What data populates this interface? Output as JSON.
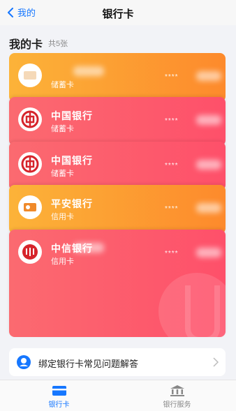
{
  "nav": {
    "back_label": "我的",
    "title": "银行卡"
  },
  "section": {
    "title": "我的卡",
    "count": "共5张"
  },
  "cards": [
    {
      "name": "",
      "type": "储蓄卡",
      "mask": "****"
    },
    {
      "name": "中国银行",
      "type": "储蓄卡",
      "mask": "****"
    },
    {
      "name": "中国银行",
      "type": "储蓄卡",
      "mask": "****"
    },
    {
      "name": "平安银行",
      "type": "信用卡",
      "mask": "****"
    },
    {
      "name": "中信银行",
      "type": "信用卡",
      "mask": "****"
    }
  ],
  "faq": {
    "text": "绑定银行卡常见问题解答"
  },
  "tabs": [
    {
      "label": "银行卡",
      "active": true
    },
    {
      "label": "银行服务",
      "active": false
    }
  ],
  "colors": {
    "accent": "#1677ff",
    "orange_card": "#fd8a2c",
    "red_card": "#fe506a",
    "boc_red": "#d6242b"
  }
}
